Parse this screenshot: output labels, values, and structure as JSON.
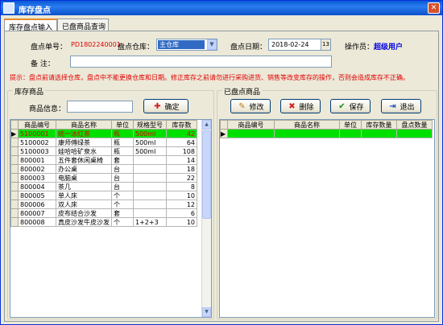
{
  "window": {
    "title": "库存盘点"
  },
  "tabs": [
    "库存盘点输入",
    "已盘商品查询"
  ],
  "form": {
    "order_no_label": "盘点单号：",
    "order_no_value": "PD1802240001",
    "warehouse_label": "盘点仓库：",
    "warehouse_value": "主仓库",
    "date_label": "盘点日期：",
    "date_value": "2018-02-24",
    "date_btn": "13",
    "operator_label": "操作员：",
    "operator_value": "超级用户",
    "remark_label": "备    注：",
    "remark_value": ""
  },
  "tip": "提示：盘点前请选择仓库，盘点中不能更换仓库和日期。修正库存之前请勿进行采购进货、销售等改变库存的操作，否则会造成库存不正确。",
  "stock_group": {
    "title": "库存商品",
    "search_label": "商品信息：",
    "search_value": "",
    "confirm_label": "确定",
    "columns": [
      "商品编号",
      "商品名称",
      "单位",
      "规格型号",
      "库存数"
    ],
    "rows": [
      [
        "5100001",
        "统一冰红茶",
        "瓶",
        "500ml",
        "42"
      ],
      [
        "5100002",
        "康师傅绿茶",
        "瓶",
        "500ml",
        "64"
      ],
      [
        "5100003",
        "娃哈哈矿泉水",
        "瓶",
        "500ml",
        "108"
      ],
      [
        "800001",
        "五件套休闲桌椅",
        "套",
        "",
        "14"
      ],
      [
        "800002",
        "办公桌",
        "台",
        "",
        "18"
      ],
      [
        "800003",
        "电脑桌",
        "台",
        "",
        "22"
      ],
      [
        "800004",
        "茶几",
        "台",
        "",
        "8"
      ],
      [
        "800005",
        "单人床",
        "个",
        "",
        "10"
      ],
      [
        "800006",
        "双人床",
        "个",
        "",
        "12"
      ],
      [
        "800007",
        "皮布结合沙发",
        "套",
        "",
        "6"
      ],
      [
        "800008",
        "真皮沙发牛皮沙发",
        "个",
        "1+2+3",
        "10"
      ]
    ]
  },
  "counted_group": {
    "title": "已盘点商品",
    "edit_label": "修改",
    "delete_label": "删除",
    "save_label": "保存",
    "exit_label": "退出",
    "columns": [
      "商品编号",
      "商品名称",
      "单位",
      "库存数量",
      "盘点数量"
    ]
  },
  "icons": {
    "app": "app-icon",
    "close": "close-icon",
    "confirm": "plus-icon",
    "edit": "pencil-icon",
    "delete": "x-icon",
    "save": "check-icon",
    "exit": "exit-icon"
  },
  "colors": {
    "selected_row_bg": "#00e000",
    "selected_row_fg": "#e00000",
    "tip": "#e00000",
    "operator": "#0000e0"
  }
}
